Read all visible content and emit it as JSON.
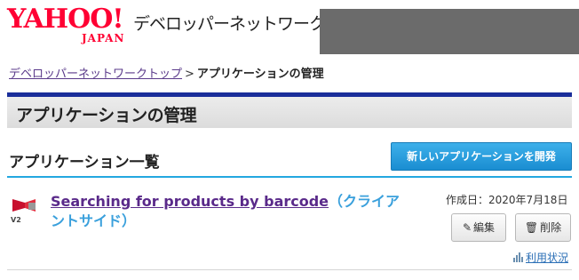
{
  "header": {
    "logo_text": "YAHOO!",
    "logo_sub": "JAPAN",
    "site_name": "デベロッパーネットワーク"
  },
  "breadcrumb": {
    "link": "デベロッパーネットワークトップ",
    "separator": ">",
    "current": "アプリケーションの管理"
  },
  "page": {
    "title": "アプリケーションの管理"
  },
  "section": {
    "heading": "アプリケーション一覧",
    "new_app_button": "新しいアプリケーションを開発"
  },
  "app": {
    "icon": "app-icon",
    "icon_version": "V2",
    "name": "Searching for products by barcode",
    "type": "（クライアントサイド）",
    "created": "作成日：2020年7月18日",
    "edit_label": "編集",
    "delete_label": "削除",
    "usage_label": "利用状況"
  },
  "colors": {
    "brand_red": "#ff0033",
    "title_bar_border": "#1a2e9a",
    "primary_button": "#1a8dd1",
    "section_line": "#23a7e0",
    "link_purple": "#5a2a8a"
  }
}
